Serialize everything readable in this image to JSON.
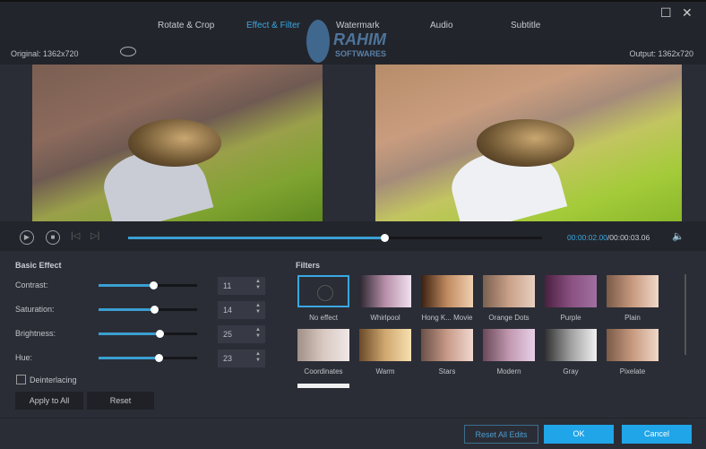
{
  "tabs": [
    {
      "label": "Rotate & Crop"
    },
    {
      "label": "Effect & Filter",
      "active": true
    },
    {
      "label": "Watermark"
    },
    {
      "label": "Audio"
    },
    {
      "label": "Subtitle"
    }
  ],
  "watermark": {
    "line1": "RAHIM",
    "line2": "SOFTWARES"
  },
  "preview": {
    "original_label": "Original: 1362x720",
    "output_label": "Output: 1362x720"
  },
  "player": {
    "current_time": "00:00:02.00",
    "total_time": "/00:00:03.06",
    "progress": 0.62
  },
  "basic_effect": {
    "title": "Basic Effect",
    "sliders": [
      {
        "label": "Contrast:",
        "value": "11",
        "fraction": 0.55
      },
      {
        "label": "Saturation:",
        "value": "14",
        "fraction": 0.56
      },
      {
        "label": "Brightness:",
        "value": "25",
        "fraction": 0.62
      },
      {
        "label": "Hue:",
        "value": "23",
        "fraction": 0.61
      }
    ],
    "deinterlacing_label": "Deinterlacing",
    "deinterlacing_checked": false,
    "apply_all": "Apply to All",
    "reset": "Reset"
  },
  "filters": {
    "title": "Filters",
    "items": [
      {
        "name": "No effect",
        "selected": true
      },
      {
        "name": "Whirlpool"
      },
      {
        "name": "Hong K... Movie"
      },
      {
        "name": "Orange Dots"
      },
      {
        "name": "Purple"
      },
      {
        "name": "Plain"
      },
      {
        "name": "Coordinates"
      },
      {
        "name": "Warm"
      },
      {
        "name": "Stars"
      },
      {
        "name": "Modern"
      },
      {
        "name": "Gray"
      },
      {
        "name": "Pixelate"
      }
    ]
  },
  "footer": {
    "reset_all": "Reset All Edits",
    "ok": "OK",
    "cancel": "Cancel"
  },
  "colors": {
    "accent": "#3aa7e0",
    "ok_bg": "#1fa5e8"
  }
}
